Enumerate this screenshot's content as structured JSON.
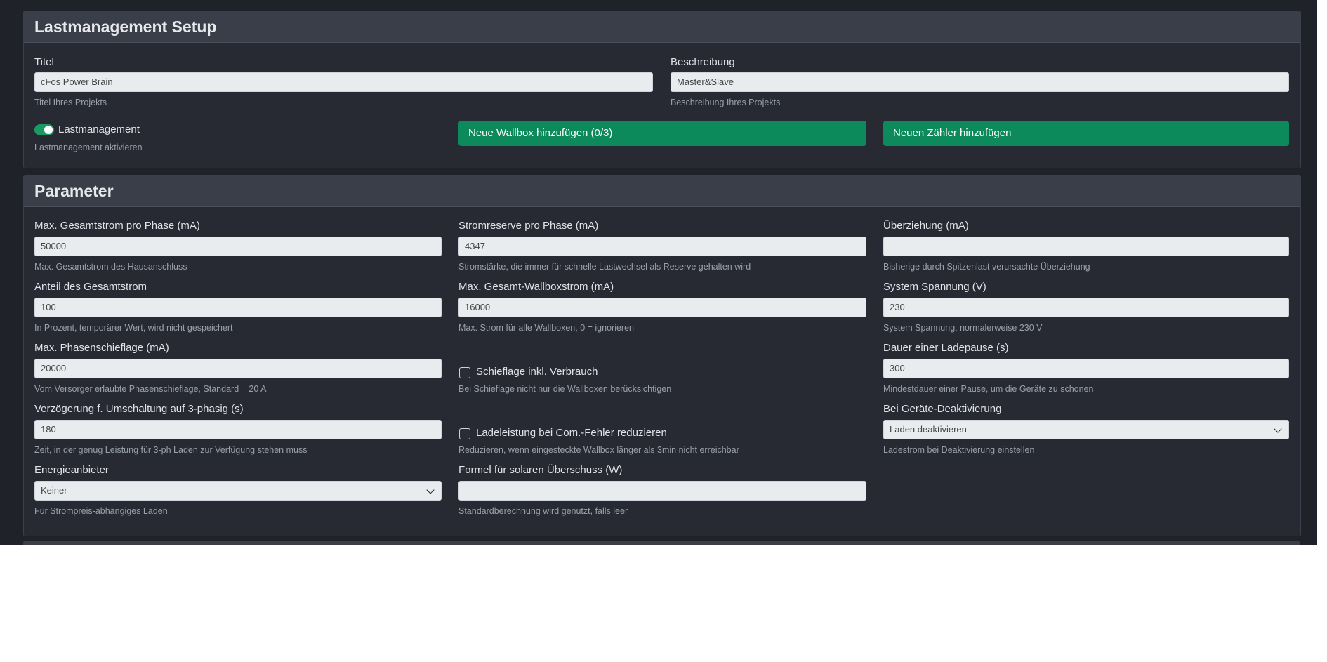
{
  "setup": {
    "title": "Lastmanagement Setup",
    "titel_label": "Titel",
    "titel_value": "cFos Power Brain",
    "titel_help": "Titel Ihres Projekts",
    "beschreibung_label": "Beschreibung",
    "beschreibung_value": "Master&Slave",
    "beschreibung_help": "Beschreibung Ihres Projekts",
    "lastmanagement_label": "Lastmanagement",
    "lastmanagement_help": "Lastmanagement aktivieren",
    "lastmanagement_enabled": true,
    "add_wallbox_label": "Neue Wallbox hinzufügen (0/3)",
    "add_meter_label": "Neuen Zähler hinzufügen",
    "accent_green": "#0d8a5c"
  },
  "parameter": {
    "title": "Parameter",
    "max_gesamtstrom": {
      "label": "Max. Gesamtstrom pro Phase (mA)",
      "value": "50000",
      "help": "Max. Gesamtstrom des Hausanschluss"
    },
    "stromreserve": {
      "label": "Stromreserve pro Phase (mA)",
      "value": "4347",
      "help": "Stromstärke, die immer für schnelle Lastwechsel als Reserve gehalten wird"
    },
    "ueberziehung": {
      "label": "Überziehung (mA)",
      "value": "",
      "help": "Bisherige durch Spitzenlast verursachte Überziehung"
    },
    "anteil": {
      "label": "Anteil des Gesamtstrom",
      "value": "100",
      "help": "In Prozent, temporärer Wert, wird nicht gespeichert"
    },
    "max_wallboxstrom": {
      "label": "Max. Gesamt-Wallboxstrom (mA)",
      "value": "16000",
      "help": "Max. Strom für alle Wallboxen, 0 = ignorieren"
    },
    "system_spannung": {
      "label": "System Spannung (V)",
      "value": "230",
      "help": "System Spannung, normalerweise 230 V"
    },
    "phasenschieflage": {
      "label": "Max. Phasenschieflage (mA)",
      "value": "20000",
      "help": "Vom Versorger erlaubte Phasenschieflage, Standard = 20 A"
    },
    "schieflage_verbrauch": {
      "label": "Schieflage inkl. Verbrauch",
      "help": "Bei Schieflage nicht nur die Wallboxen berücksichtigen",
      "checked": false
    },
    "ladepause": {
      "label": "Dauer einer Ladepause (s)",
      "value": "300",
      "help": "Mindestdauer einer Pause, um die Geräte zu schonen"
    },
    "verzoegerung": {
      "label": "Verzögerung f. Umschaltung auf 3-phasig (s)",
      "value": "180",
      "help": "Zeit, in der genug Leistung für 3-ph Laden zur Verfügung stehen muss"
    },
    "ladeleistung_reduzieren": {
      "label": "Ladeleistung bei Com.-Fehler reduzieren",
      "help": "Reduzieren, wenn eingesteckte Wallbox länger als 3min nicht erreichbar",
      "checked": false
    },
    "geraete_deaktivierung": {
      "label": "Bei Geräte-Deaktivierung",
      "value": "Laden deaktivieren",
      "help": "Ladestrom bei Deaktivierung einstellen"
    },
    "energieanbieter": {
      "label": "Energieanbieter",
      "value": "Keiner",
      "help": "Für Strompreis-abhängiges Laden"
    },
    "formel": {
      "label": "Formel für solaren Überschuss (W)",
      "value": "",
      "help": "Standardberechnung wird genutzt, falls leer"
    }
  }
}
